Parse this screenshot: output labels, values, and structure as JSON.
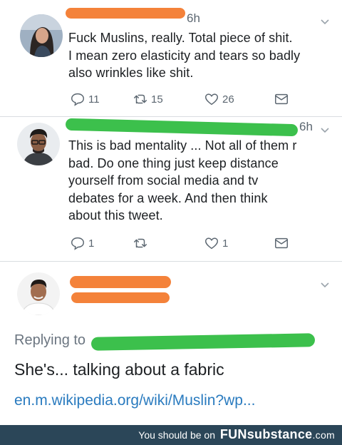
{
  "tweets": [
    {
      "time": "6h",
      "text_lines": [
        "Fuck Muslins, really. Total piece of shit.",
        "I mean zero elasticity and tears so badly",
        "also wrinkles like shit."
      ],
      "reply_count": "11",
      "retweet_count": "15",
      "like_count": "26"
    },
    {
      "time": "6h",
      "text_lines": [
        "This is bad mentality ... Not all of them r",
        "bad. Do one thing just keep distance",
        "yourself from social media and tv",
        "debates for a week. And then think",
        "about this tweet."
      ],
      "reply_count": "1",
      "retweet_count": "",
      "like_count": "1"
    }
  ],
  "reply": {
    "replying_to": "Replying to",
    "text": "She's... talking about a fabric",
    "link": "en.m.wikipedia.org/wiki/Muslin?wp..."
  },
  "footer": {
    "label": "You should be on",
    "brand_fun": "FUN",
    "brand_sub": "substance",
    "brand_dom": ".com"
  },
  "colors": {
    "redaction_orange": "#f4823a",
    "redaction_green": "#3cc04c",
    "link": "#2a7bbf",
    "footer_bg": "#2b4658"
  }
}
